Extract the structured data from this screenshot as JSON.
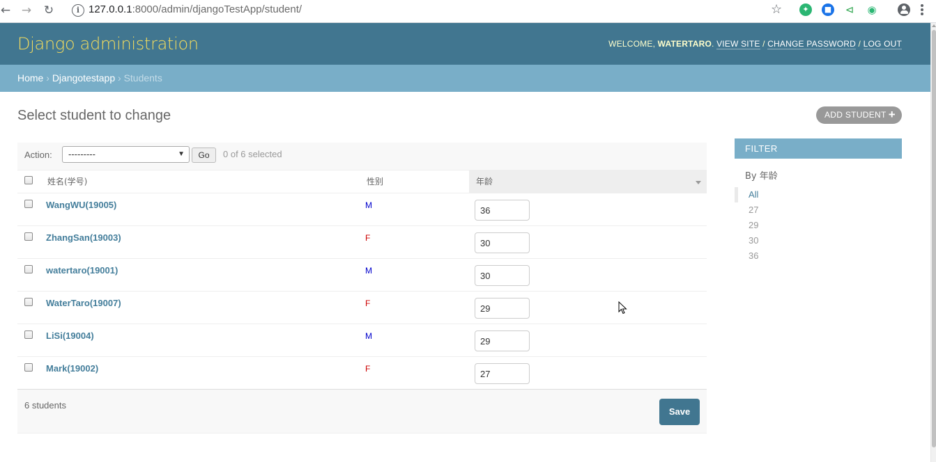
{
  "browser": {
    "url_host": "127.0.0.1",
    "url_rest": ":8000/admin/djangoTestApp/student/"
  },
  "header": {
    "branding": "Django administration",
    "welcome": "WELCOME, ",
    "username": "WATERTARO",
    "view_site": "VIEW SITE",
    "change_password": "CHANGE PASSWORD",
    "log_out": "LOG OUT"
  },
  "breadcrumbs": {
    "home": "Home",
    "app": "Djangotestapp",
    "current": "Students"
  },
  "content": {
    "title": "Select student to change",
    "add_button": "ADD STUDENT"
  },
  "actions": {
    "label": "Action:",
    "selected_option": "---------",
    "go": "Go",
    "counter": "0 of 6 selected"
  },
  "table": {
    "headers": [
      "姓名(学号)",
      "性别",
      "年龄"
    ],
    "rows": [
      {
        "name": "WangWU(19005)",
        "gender": "M",
        "age": "36"
      },
      {
        "name": "ZhangSan(19003)",
        "gender": "F",
        "age": "30"
      },
      {
        "name": "watertaro(19001)",
        "gender": "M",
        "age": "30"
      },
      {
        "name": "WaterTaro(19007)",
        "gender": "F",
        "age": "29"
      },
      {
        "name": "LiSi(19004)",
        "gender": "M",
        "age": "29"
      },
      {
        "name": "Mark(19002)",
        "gender": "F",
        "age": "27"
      }
    ]
  },
  "footer": {
    "count": "6 students",
    "save": "Save"
  },
  "filter": {
    "title": "FILTER",
    "by": "By 年龄",
    "options": [
      "All",
      "27",
      "29",
      "30",
      "36"
    ]
  },
  "colors": {
    "header_bg": "#417690",
    "branding": "#f5dd5d",
    "breadcrumb_bg": "#79aec8",
    "link": "#447e9b",
    "male": "#0000cc",
    "female": "#cc0000"
  }
}
